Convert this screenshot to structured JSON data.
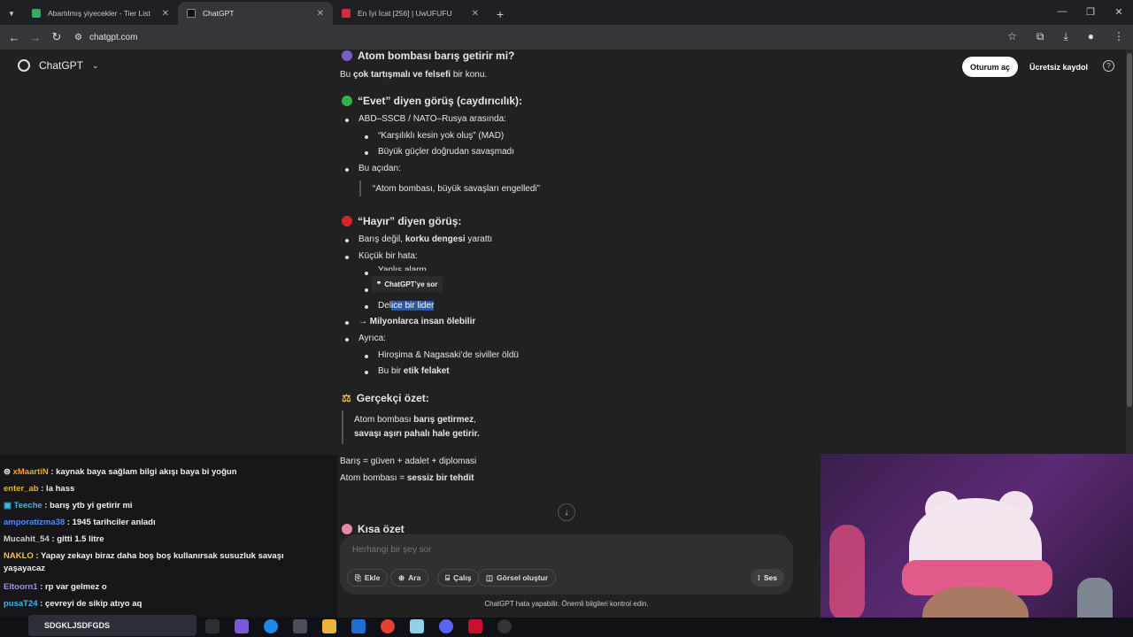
{
  "browser": {
    "tabs": [
      {
        "label": "Abartılmış yiyecekler - Tier List"
      },
      {
        "label": "ChatGPT"
      },
      {
        "label": "En İyi İcat [256] | UwUFUFU"
      }
    ],
    "new_tab": "+",
    "url": "chatgpt.com"
  },
  "header": {
    "app_name": "ChatGPT",
    "login": "Oturum aç",
    "signup": "Ücretsiz kaydol",
    "help": "?"
  },
  "content": {
    "title": "Atom bombası barış getirir mi?",
    "intro_pre": "Bu ",
    "intro_bold": "çok tartışmalı ve felsefi",
    "intro_post": " bir konu.",
    "yes_heading": "“Evet” diyen görüş (caydırıcılık):",
    "yes_1": "ABD–SSCB / NATO–Rusya arasında:",
    "yes_1a": "“Karşılıklı kesin yok oluş” (MAD)",
    "yes_1b": "Büyük güçler doğrudan savaşmadı",
    "yes_2": "Bu açıdan:",
    "yes_quote": "“Atom bombası, büyük savaşları engelledi”",
    "no_heading": "“Hayır” diyen görüş:",
    "no_1_pre": "Barış değil, ",
    "no_1_bold": "korku dengesi",
    "no_1_post": " yarattı",
    "no_2": "Küçük bir hata:",
    "no_2a": "Yanlış alarm",
    "no_2c_pre": "Del",
    "no_2c_sel": "ice bir lider",
    "no_3": "→ Milyonlarca insan ölebilir",
    "no_4": "Ayrıca:",
    "no_4a": "Hiroşima & Nagasaki’de siviller öldü",
    "no_4b_pre": "Bu bir ",
    "no_4b_bold": "etik felaket",
    "summary_heading": "Gerçekçi özet:",
    "summary_q1_pre": "Atom bombası ",
    "summary_q1_bold": "barış getirmez",
    "summary_q1_post": ",",
    "summary_q2": "savaşı aşırı pahalı hale getirir.",
    "eq1": "Barış = güven + adalet + diplomasi",
    "eq2_pre": "Atom bombası = ",
    "eq2_bold": "sessiz bir tehdit",
    "short_heading": "Kısa özet",
    "tooltip": "ChatGPT’ye sor"
  },
  "composer": {
    "placeholder": "Herhangi bir şey sor",
    "add": "Ekle",
    "search": "Ara",
    "study": "Çalış",
    "image": "Görsel oluştur",
    "voice": "Ses",
    "disclaimer": "ChatGPT hata yapabilir. Önemli bilgileri kontrol edin."
  },
  "chat": [
    {
      "user": "xMaartiN",
      "msg": " : kaynak baya sağlam bilgi akışı baya bi yoğun",
      "color": "#f5a623"
    },
    {
      "user": "enter_ab",
      "msg": " : la hass",
      "color": "#e3b341"
    },
    {
      "user": "Teeche",
      "msg": " : barış ytb yi getirir mi",
      "color": "#3fb6e8"
    },
    {
      "user": "amporatizma38",
      "msg": " : 1945 tarihciler anladı",
      "color": "#4c8df6"
    },
    {
      "user": "Mucahit_54",
      "msg": " : gitti 1.5 litre",
      "color": "#cfcfcf"
    },
    {
      "user": "NAKLO",
      "msg": " : Yapay zekayı biraz daha boş boş kullanırsak susuzluk savaşı",
      "color": "#f5c04a"
    },
    {
      "user": "",
      "msg": "yaşayacaz",
      "color": "#f1f1f1"
    },
    {
      "user": "Eltoorn1",
      "msg": " : rp var gelmez o",
      "color": "#a98bf0"
    },
    {
      "user": "pusaT24",
      "msg": " : çevreyi de sikip atıyo aq",
      "color": "#3fb6e8"
    }
  ],
  "taskbar": {
    "search": "SDGKLJSDFGDS"
  },
  "colors": {
    "green": "#2fb344",
    "red": "#d9252a",
    "accent": "#2d5a9e"
  }
}
